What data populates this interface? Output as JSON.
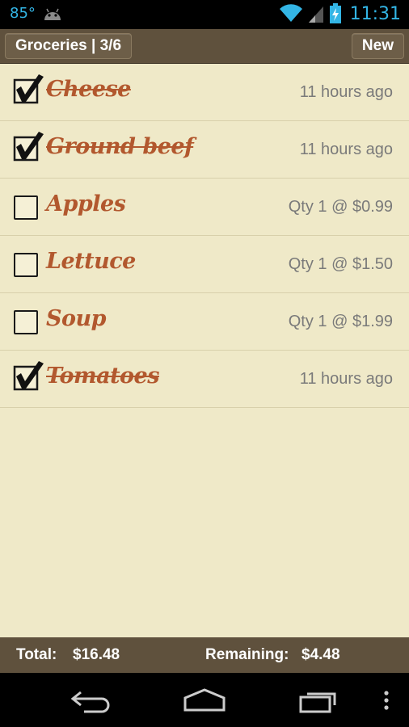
{
  "status_bar": {
    "temperature": "85°",
    "time": "11:31",
    "icons": [
      "android-icon",
      "wifi-icon",
      "signal-icon",
      "battery-charging-icon"
    ]
  },
  "header": {
    "title": "Groceries | 3/6",
    "new_label": "New"
  },
  "items": [
    {
      "name": "Cheese",
      "checked": true,
      "meta": "11 hours ago"
    },
    {
      "name": "Ground beef",
      "checked": true,
      "meta": "11 hours ago"
    },
    {
      "name": "Apples",
      "checked": false,
      "meta": "Qty 1 @ $0.99"
    },
    {
      "name": "Lettuce",
      "checked": false,
      "meta": "Qty 1 @ $1.50"
    },
    {
      "name": "Soup",
      "checked": false,
      "meta": "Qty 1 @ $1.99"
    },
    {
      "name": "Tomatoes",
      "checked": true,
      "meta": "11 hours ago"
    }
  ],
  "totals": {
    "total_label": "Total:",
    "total_value": "$16.48",
    "remaining_label": "Remaining:",
    "remaining_value": "$4.48"
  },
  "navbar": {
    "icons": [
      "back-icon",
      "home-icon",
      "recent-apps-icon",
      "overflow-menu-icon"
    ]
  },
  "colors": {
    "accent": "#33b5e5",
    "header": "#5f513d",
    "list_bg": "#efe9c8",
    "item_text": "#b2582e"
  }
}
